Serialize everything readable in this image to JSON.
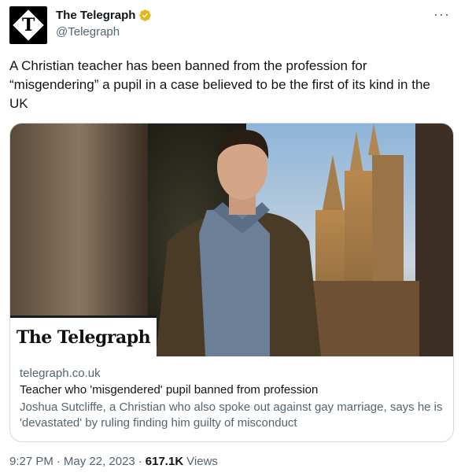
{
  "author": {
    "display_name": "The Telegraph",
    "handle": "@Telegraph",
    "avatar_letter": "T",
    "verified_color": "#e2b719"
  },
  "more_icon": "more-horizontal-icon",
  "tweet": {
    "text": "A Christian teacher has been banned from the profession for “misgendering” a pupil in a case believed to be the first of its kind in the UK"
  },
  "card": {
    "logo_text": "The Telegraph",
    "domain": "telegraph.co.uk",
    "title": "Teacher who 'misgendered' pupil banned from profession",
    "description": "Joshua Sutcliffe, a Christian who also spoke out against gay marriage, says he is 'devastated' by ruling finding him guilty of misconduct"
  },
  "footer": {
    "time": "9:27 PM",
    "sep1": "·",
    "date": "May 22, 2023",
    "sep2": "·",
    "views_count": "617.1K",
    "views_label": "Views"
  },
  "colors": {
    "text_primary": "#0f1419",
    "text_secondary": "#536471",
    "border": "#cfd9de"
  }
}
